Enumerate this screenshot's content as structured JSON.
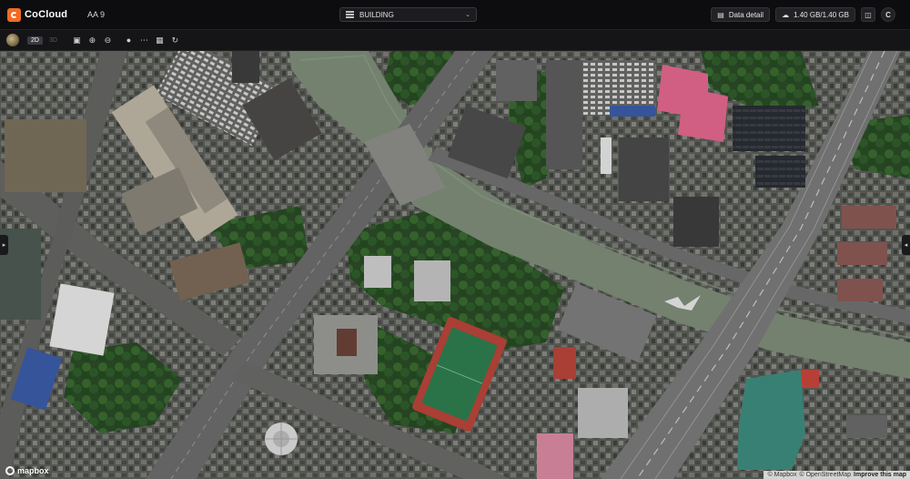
{
  "header": {
    "brand": "CoCloud",
    "project": "AA 9",
    "layer_select": {
      "value": "BUILDING",
      "icon": "layers-icon"
    },
    "data_detail": {
      "label": "Data detail",
      "icon": "data-detail-icon"
    },
    "storage": {
      "label": "1.40 GB/1.40 GB",
      "icon": "cloud-upload-icon"
    },
    "extra_buttons": [
      "translate-icon",
      "user-avatar-icon"
    ]
  },
  "toolbar": {
    "view_modes": [
      {
        "label": "2D",
        "active": true
      },
      {
        "label": "3D",
        "active": false
      }
    ],
    "tools": [
      "fit-view-icon",
      "zoom-in-icon",
      "zoom-out-icon",
      "marker-icon",
      "measure-line-icon",
      "measure-area-icon",
      "rotate-icon"
    ]
  },
  "map": {
    "logo": "mapbox",
    "attribution": [
      "© Mapbox",
      "© OpenStreetMap",
      "Improve this map"
    ],
    "colors": {
      "river": "#7d8d78",
      "road": "#6c6c6c",
      "vegetation": "#2f5d2b",
      "sports_field": "#2e7d4f",
      "track": "#b8453a",
      "pink_roof": "#e2688f",
      "blue_roof": "#3b5ca8"
    }
  }
}
